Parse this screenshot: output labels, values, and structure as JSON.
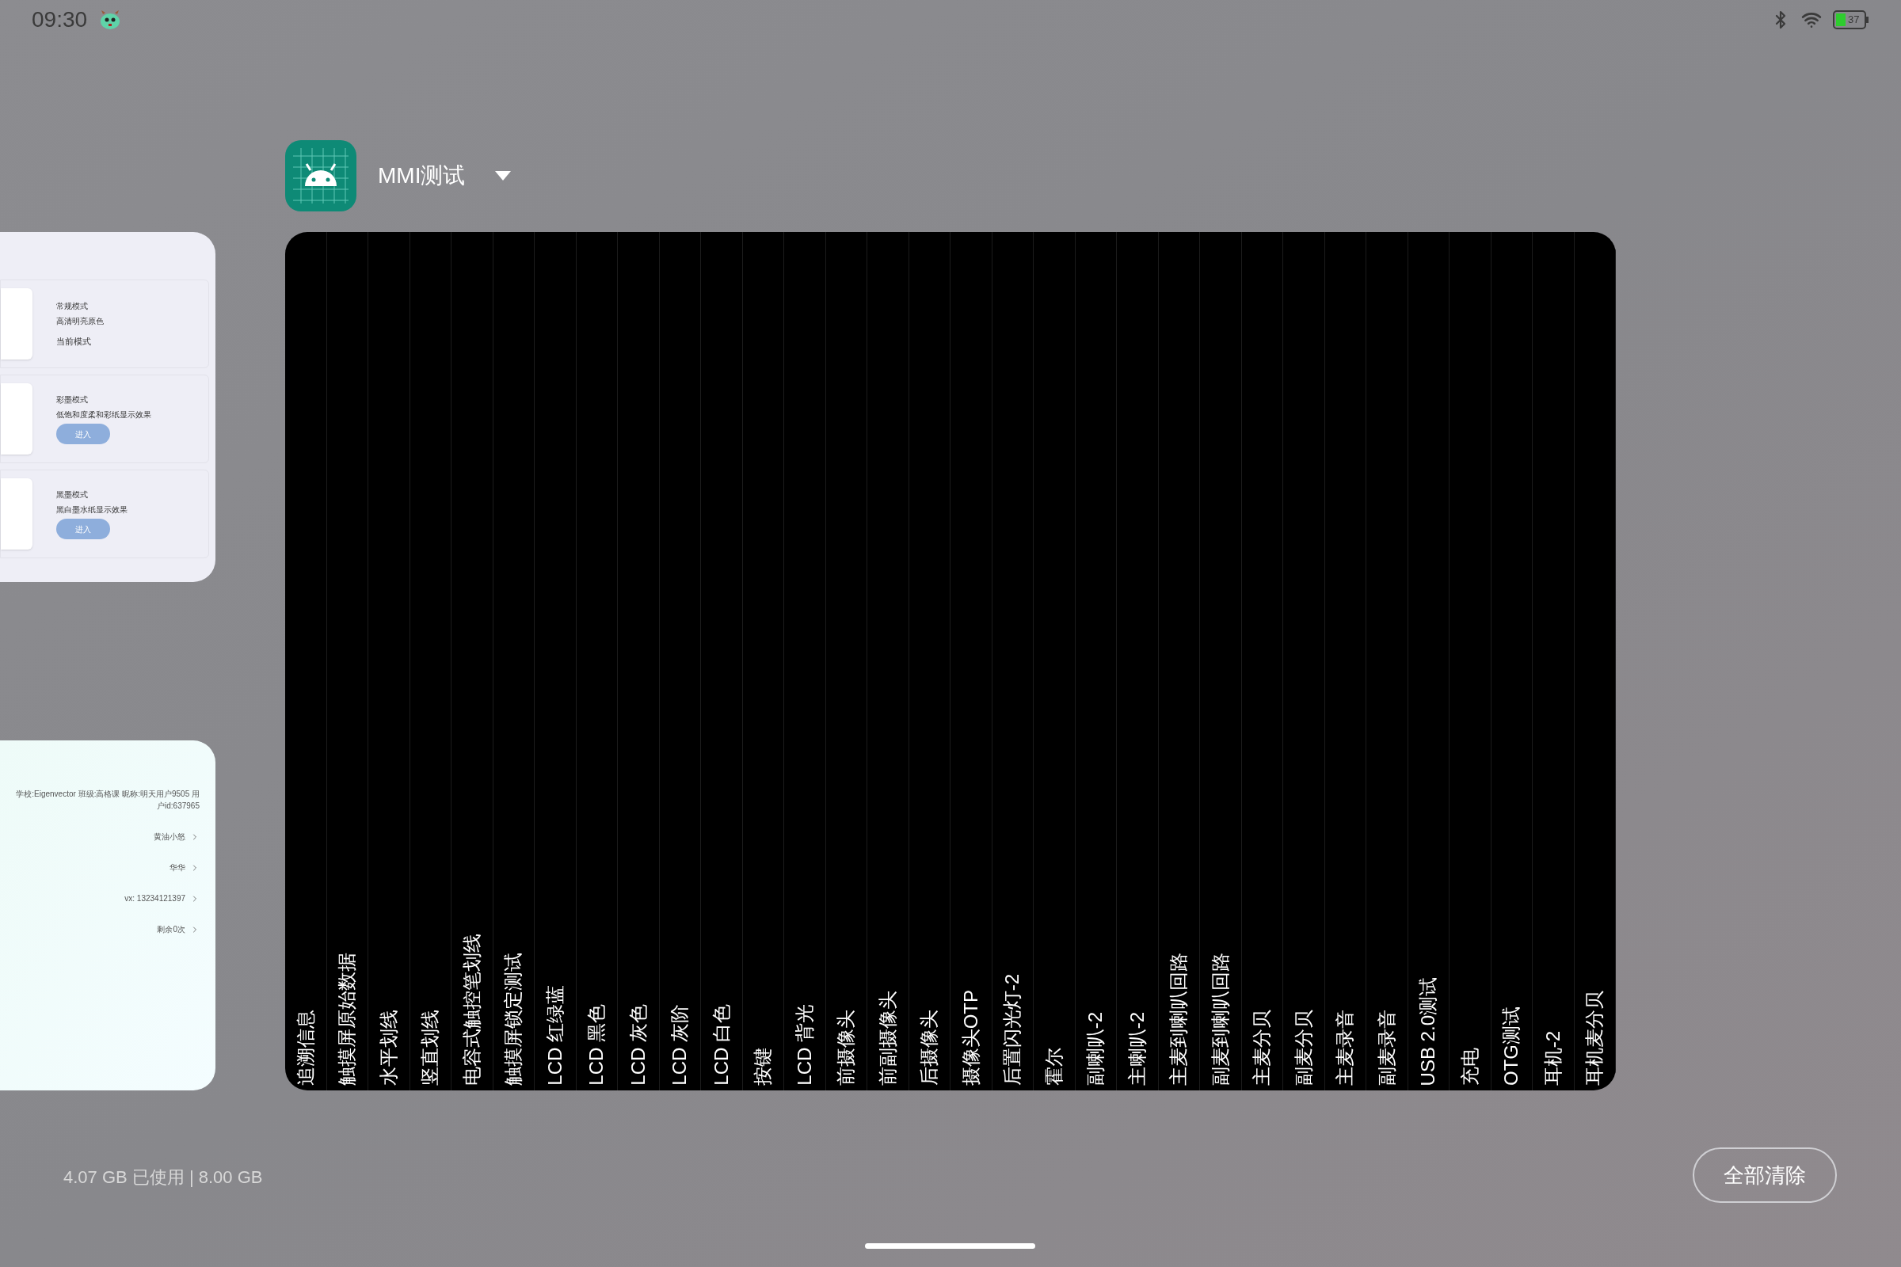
{
  "status_bar": {
    "time": "09:30",
    "battery": "37"
  },
  "left_card_top": {
    "rows": [
      {
        "title": "常规模式",
        "subtitle": "高清明亮原色",
        "status": "当前模式"
      },
      {
        "title": "彩墨模式",
        "subtitle": "低饱和度柔和彩纸显示效果",
        "button": "进入"
      },
      {
        "title": "黑墨模式",
        "subtitle": "黑白墨水纸显示效果",
        "button": "进入"
      }
    ]
  },
  "left_card_bottom": {
    "info": "学校:Eigenvector 班级:高格课 昵称:明天用户9505 用户id:637965",
    "items": [
      "黄油小怒",
      "华华",
      "vx: 13234121397",
      "剩余0次"
    ]
  },
  "app": {
    "title": "MMI测试"
  },
  "test_items": [
    "追溯信息",
    "触摸屏原始数据",
    "水平划线",
    "竖直划线",
    "电容式触控笔划线",
    "触摸屏锁定测试",
    "LCD 红绿蓝",
    "LCD 黑色",
    "LCD 灰色",
    "LCD 灰阶",
    "LCD 白色",
    "按键",
    "LCD 背光",
    "前摄像头",
    "前副摄像头",
    "后摄像头",
    "摄像头OTP",
    "后置闪光灯-2",
    "霍尔",
    "副喇叭-2",
    "主喇叭-2",
    "主麦到喇叭回路",
    "副麦到喇叭回路",
    "主麦分贝",
    "副麦分贝",
    "主麦录音",
    "副麦录音",
    "USB 2.0测试",
    "充电",
    "OTG测试",
    "耳机-2",
    "耳机麦分贝"
  ],
  "memory": "4.07 GB 已使用 | 8.00 GB",
  "clear_all": "全部清除"
}
